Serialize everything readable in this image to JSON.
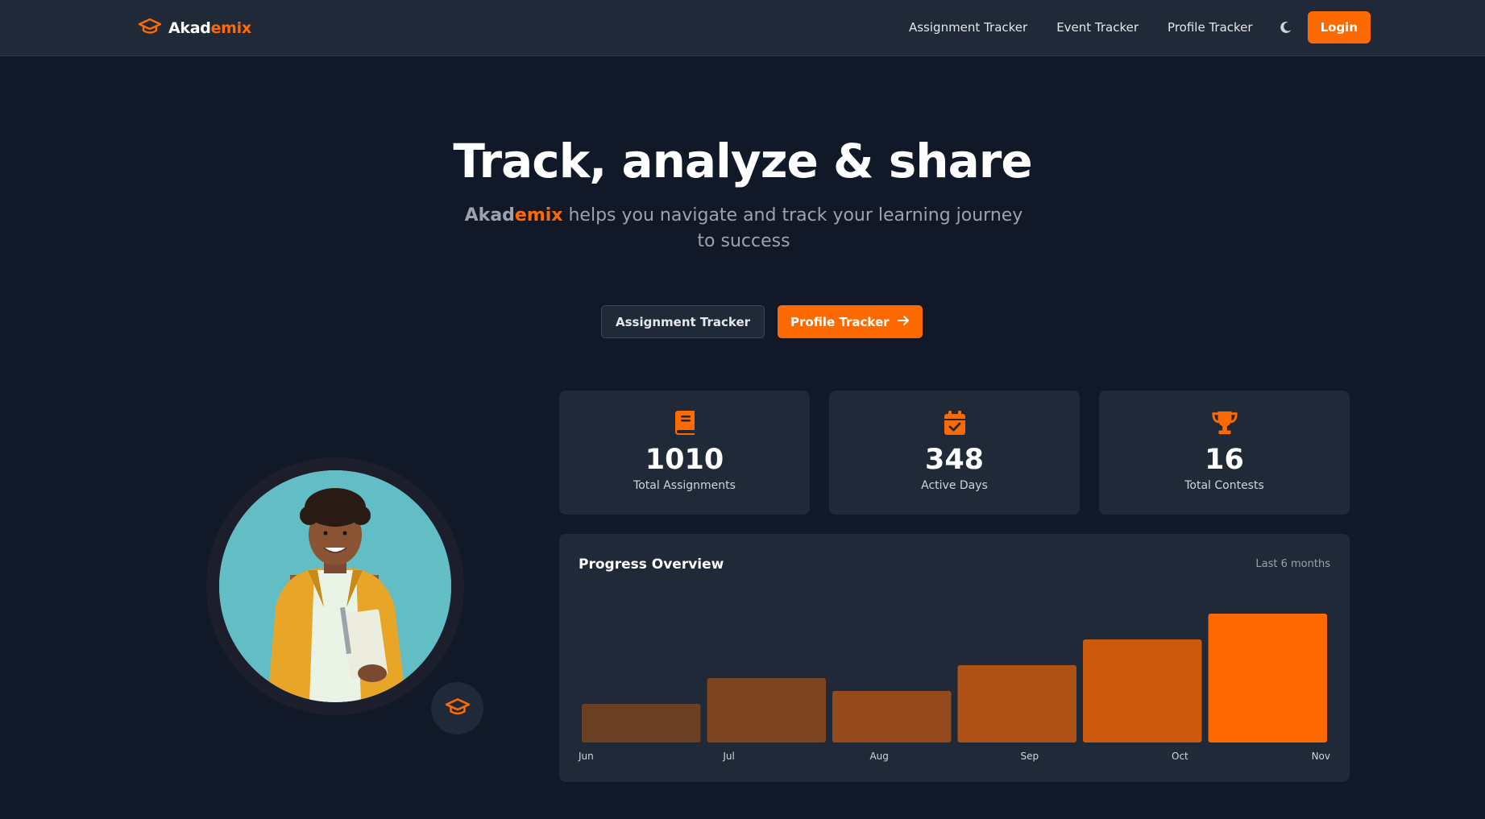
{
  "brand": {
    "name_part1": "Akad",
    "name_part2": "emix"
  },
  "nav": {
    "links": [
      "Assignment Tracker",
      "Event Tracker",
      "Profile Tracker"
    ],
    "login_label": "Login",
    "theme_icon": "moon-icon"
  },
  "hero": {
    "title": "Track, analyze & share",
    "subtitle_brand_part1": "Akad",
    "subtitle_brand_part2": "emix",
    "subtitle_text": " helps you navigate and track your learning journey to success",
    "cta_secondary": "Assignment Tracker",
    "cta_primary": "Profile Tracker"
  },
  "stats": [
    {
      "value": "1010",
      "label": "Total Assignments",
      "icon": "book-icon"
    },
    {
      "value": "348",
      "label": "Active Days",
      "icon": "calendar-check-icon"
    },
    {
      "value": "16",
      "label": "Total Contests",
      "icon": "trophy-icon"
    }
  ],
  "chart_data": {
    "type": "bar",
    "title": "Progress Overview",
    "range_label": "Last 6 months",
    "categories": [
      "Jun",
      "Jul",
      "Aug",
      "Sep",
      "Oct",
      "Nov"
    ],
    "values": [
      30,
      50,
      40,
      60,
      80,
      100
    ],
    "ylim": [
      0,
      100
    ],
    "bar_colors": [
      "#6b3f22",
      "#7e4420",
      "#944a1c",
      "#ad5116",
      "#cc5a0d",
      "#ff6a00"
    ],
    "grid": false,
    "xlabel": "",
    "ylabel": ""
  },
  "colors": {
    "accent": "#ff6a00",
    "background": "#111827",
    "card": "#1f2937"
  }
}
